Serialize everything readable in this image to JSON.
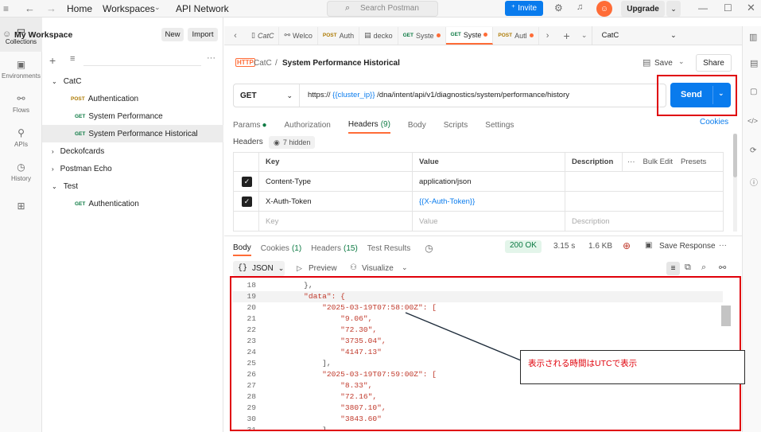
{
  "topbar": {
    "home": "Home",
    "workspaces": "Workspaces",
    "api_network": "API Network",
    "search_placeholder": "Search Postman",
    "invite": "Invite",
    "upgrade": "Upgrade"
  },
  "rail": {
    "items": [
      {
        "label": "Collections",
        "icon": "collections-icon"
      },
      {
        "label": "Environments",
        "icon": "environments-icon"
      },
      {
        "label": "Flows",
        "icon": "flows-icon"
      },
      {
        "label": "APIs",
        "icon": "apis-icon"
      },
      {
        "label": "History",
        "icon": "history-icon"
      }
    ]
  },
  "sidebar": {
    "workspace": "My Workspace",
    "new": "New",
    "import": "Import",
    "tree": {
      "catc": "CatC",
      "catc_items": [
        {
          "method": "POST",
          "label": "Authentication"
        },
        {
          "method": "GET",
          "label": "System Performance"
        },
        {
          "method": "GET",
          "label": "System Performance Historical"
        }
      ],
      "deck": "Deckofcards",
      "echo": "Postman Echo",
      "test": "Test",
      "test_items": [
        {
          "method": "GET",
          "label": "Authentication"
        }
      ]
    }
  },
  "tabs": [
    {
      "kind": "catc",
      "label": "CatC"
    },
    {
      "kind": "flow",
      "label": "Welco"
    },
    {
      "kind": "POST",
      "label": "Auth"
    },
    {
      "kind": "doc",
      "label": "decko"
    },
    {
      "kind": "GET",
      "label": "Syste"
    },
    {
      "kind": "GET",
      "label": "Syste"
    },
    {
      "kind": "POST",
      "label": "Autl"
    }
  ],
  "env_select": "CatC",
  "request": {
    "crumb_parent": "CatC",
    "crumb_sep": "/",
    "crumb_title": "System Performance Historical",
    "save": "Save",
    "share": "Share",
    "method": "GET",
    "url_prefix": "https://",
    "url_var": "{{cluster_ip}}",
    "url_rest": "/dna/intent/api/v1/diagnostics/system/performance/history",
    "send": "Send",
    "subtabs": {
      "params": "Params",
      "auth": "Authorization",
      "headers": "Headers",
      "headers_count": "(9)",
      "body": "Body",
      "scripts": "Scripts",
      "settings": "Settings",
      "cookies": "Cookies"
    },
    "headers_label": "Headers",
    "hidden": "7 hidden",
    "table": {
      "col_key": "Key",
      "col_value": "Value",
      "col_desc": "Description",
      "bulk_edit": "Bulk Edit",
      "presets": "Presets",
      "rows": [
        {
          "key": "Content-Type",
          "value": "application/json"
        },
        {
          "key": "X-Auth-Token",
          "value": "{{X-Auth-Token}}"
        }
      ],
      "ph_key": "Key",
      "ph_value": "Value",
      "ph_desc": "Description"
    }
  },
  "response": {
    "tabs": {
      "body": "Body",
      "cookies": "Cookies",
      "cookies_count": "(1)",
      "headers": "Headers",
      "headers_count": "(15)",
      "tests": "Test Results"
    },
    "status": "200 OK",
    "time": "3.15 s",
    "size": "1.6 KB",
    "save_response": "Save Response",
    "format": "JSON",
    "preview": "Preview",
    "visualize": "Visualize",
    "lines": [
      {
        "n": "18",
        "text": "        },"
      },
      {
        "n": "19",
        "text": "        \"data\": {"
      },
      {
        "n": "20",
        "text": "            \"2025-03-19T07:58:00Z\": ["
      },
      {
        "n": "21",
        "text": "                \"9.06\","
      },
      {
        "n": "22",
        "text": "                \"72.30\","
      },
      {
        "n": "23",
        "text": "                \"3735.04\","
      },
      {
        "n": "24",
        "text": "                \"4147.13\""
      },
      {
        "n": "25",
        "text": "            ],"
      },
      {
        "n": "26",
        "text": "            \"2025-03-19T07:59:00Z\": ["
      },
      {
        "n": "27",
        "text": "                \"8.33\","
      },
      {
        "n": "28",
        "text": "                \"72.16\","
      },
      {
        "n": "29",
        "text": "                \"3807.10\","
      },
      {
        "n": "30",
        "text": "                \"3843.60\""
      },
      {
        "n": "31",
        "text": "            ],"
      }
    ]
  },
  "annotation": {
    "text": "表示される時間はUTCで表示"
  },
  "colors": {
    "accent": "#ff6c37",
    "send": "#097bed",
    "highlight_box": "#e0000a"
  }
}
